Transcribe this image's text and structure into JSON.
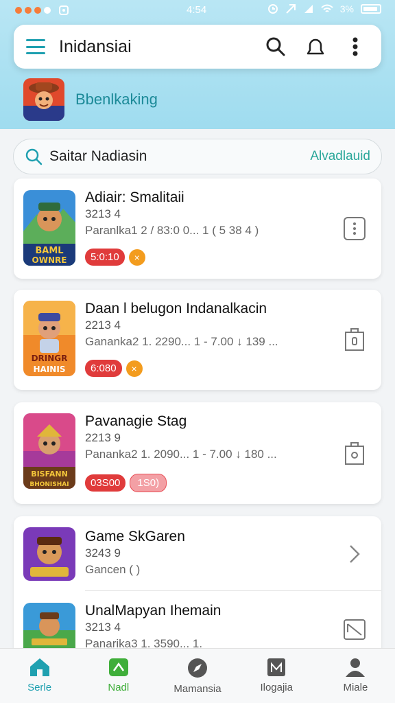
{
  "status_bar": {
    "time": "4:54",
    "battery": "3%"
  },
  "app_bar": {
    "title": "Inidansiai"
  },
  "banner": {
    "label": "Bbenlkaking"
  },
  "search": {
    "text": "Saitar Nadiasin",
    "action": "Alvadlauid"
  },
  "games": [
    {
      "title": "Adiair: Smalitaii",
      "number": "3213 4",
      "meta": "Paranlka1   2 / 83:0 0...   1 ( 5 38 4 )",
      "chip": "5:0:10",
      "chip_icon": "×",
      "art_text": "BAML OWNRE"
    },
    {
      "title": "Daan l belugon Indanalkacin",
      "number": "2213 4",
      "meta": "Gananka2   1.  2290...   1 - 7.00  ↓  139 ...",
      "chip": "6:080",
      "chip_icon": "×",
      "art_text": "DRINGR HAINIS"
    },
    {
      "title": "Pavanagie Stag",
      "number": "2213 9",
      "meta": "Pananka2   1.  2090...   1 - 7.00  ↓  180 ...",
      "chip": "03S00",
      "chip2": "1S0)",
      "art_text": "BISFANN BHONISHAI"
    },
    {
      "title": "Game SkGaren",
      "number": "3243 9",
      "meta": "Gancen ( )"
    },
    {
      "title": "UnalMapyan Ihemain",
      "number": "3213 4",
      "meta": "Panarika3   1.  3590...   1."
    }
  ],
  "bottom_nav": [
    {
      "label": "Serle",
      "color": "#1fa0b0"
    },
    {
      "label": "Nadl",
      "color": "#3fae3a"
    },
    {
      "label": "Mamansia",
      "color": "#555555"
    },
    {
      "label": "Ilogajia",
      "color": "#555555"
    },
    {
      "label": "Miale",
      "color": "#555555"
    }
  ]
}
